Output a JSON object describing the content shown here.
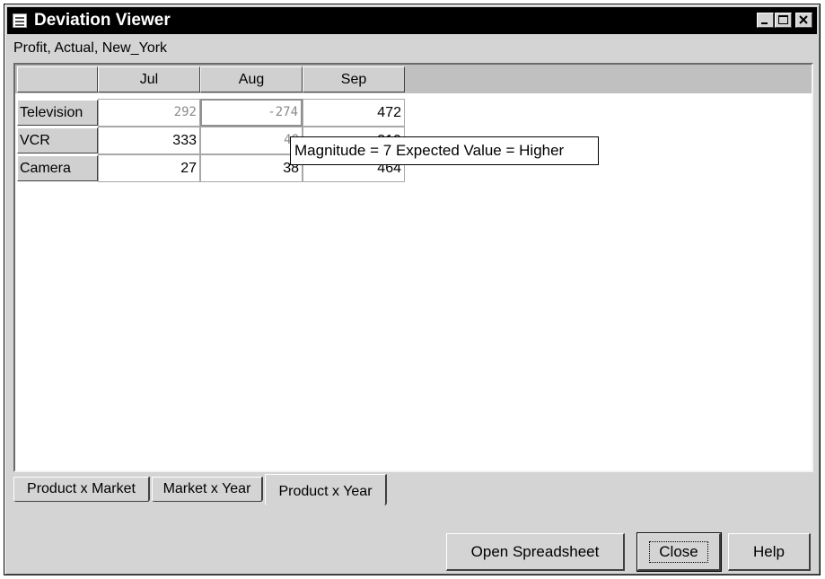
{
  "window": {
    "title": "Deviation Viewer",
    "controls": {
      "minimize": "minimize",
      "maximize": "maximize",
      "close": "close"
    }
  },
  "context": {
    "label": "Profit, Actual, New_York"
  },
  "grid": {
    "columns": [
      "Jul",
      "Aug",
      "Sep"
    ],
    "rows": [
      {
        "label": "Television",
        "cells": [
          "292",
          "-274",
          "472"
        ]
      },
      {
        "label": "VCR",
        "cells": [
          "333",
          "48",
          "319"
        ]
      },
      {
        "label": "Camera",
        "cells": [
          "27",
          "38",
          "464"
        ]
      }
    ],
    "colors": {
      "deviation_cell": "#8a8a8a",
      "normal_cell": "#000000"
    }
  },
  "tooltip": {
    "text": "Magnitude = 7  Expected Value = Higher"
  },
  "tabs": [
    {
      "label": "Product x Market",
      "active": false
    },
    {
      "label": "Market x Year",
      "active": false
    },
    {
      "label": "Product x Year",
      "active": true
    }
  ],
  "buttons": {
    "open_spreadsheet": "Open Spreadsheet",
    "close": "Close",
    "help": "Help"
  }
}
